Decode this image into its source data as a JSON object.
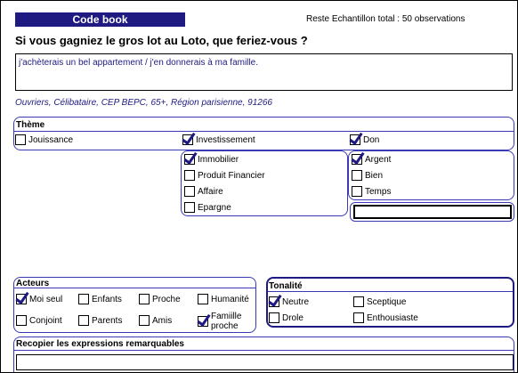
{
  "header": {
    "title": "Code book",
    "reste": "Reste  Echantillon total  : 50 observations"
  },
  "question": "Si vous gagniez le gros lot au Loto, que feriez-vous ?",
  "answer": "j'achèterais un bel appartement / j'en donnerais à ma famille.",
  "profile": "Ouvriers, Célibataire, CEP BEPC, 65+, Région parisienne, 91266",
  "theme": {
    "title": "Thème",
    "top": [
      {
        "label": "Jouissance",
        "checked": false
      },
      {
        "label": "Investissement",
        "checked": true
      },
      {
        "label": "Don",
        "checked": true
      }
    ],
    "investissement": [
      {
        "label": "Immobilier",
        "checked": true
      },
      {
        "label": "Produit Financier",
        "checked": false
      },
      {
        "label": "Affaire",
        "checked": false
      },
      {
        "label": "Epargne",
        "checked": false
      }
    ],
    "don": [
      {
        "label": "Argent",
        "checked": true
      },
      {
        "label": "Bien",
        "checked": false
      },
      {
        "label": "Temps",
        "checked": false
      }
    ]
  },
  "acteurs": {
    "title": "Acteurs",
    "items": [
      {
        "label": "Moi seul",
        "checked": true
      },
      {
        "label": "Enfants",
        "checked": false
      },
      {
        "label": "Proche",
        "checked": false
      },
      {
        "label": "Humanité",
        "checked": false
      },
      {
        "label": "Conjoint",
        "checked": false
      },
      {
        "label": "Parents",
        "checked": false
      },
      {
        "label": "Amis",
        "checked": false
      },
      {
        "label": "Famiille proche",
        "checked": true
      }
    ]
  },
  "tonalite": {
    "title": "Tonalité",
    "items": [
      {
        "label": "Neutre",
        "checked": true
      },
      {
        "label": "Sceptique",
        "checked": false
      },
      {
        "label": "Drole",
        "checked": false
      },
      {
        "label": "Enthousiaste",
        "checked": false
      }
    ]
  },
  "expressions": {
    "title": "Recopier les expressions remarquables",
    "value": ""
  }
}
